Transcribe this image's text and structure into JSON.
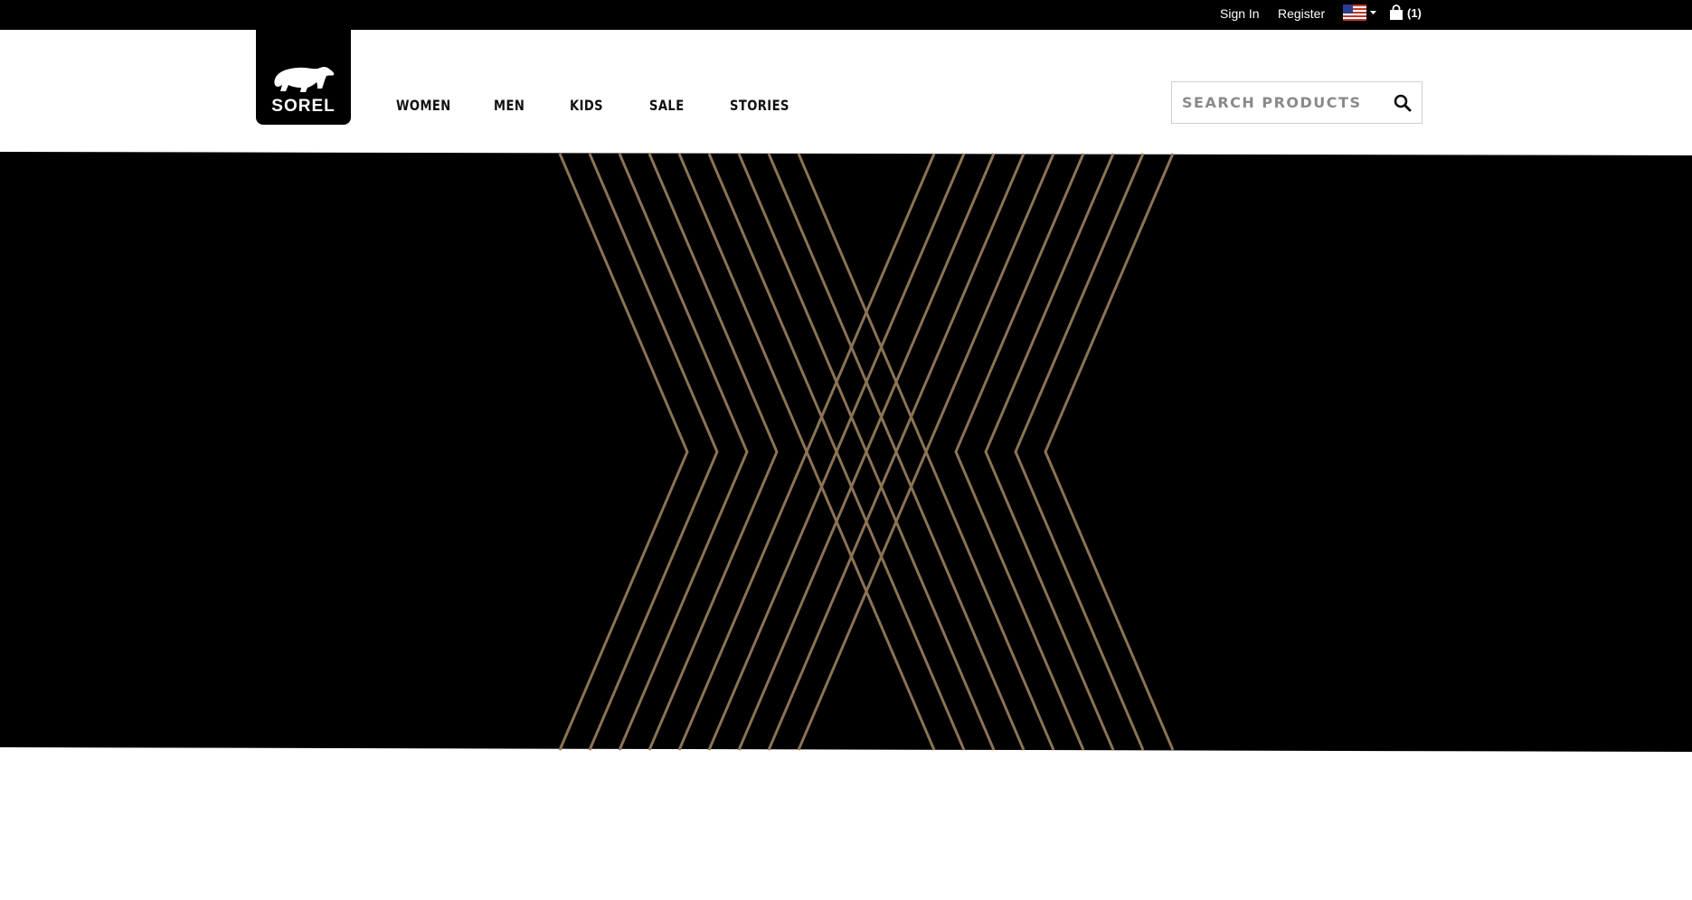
{
  "utility_bar": {
    "sign_in": "Sign In",
    "register": "Register",
    "country_icon": "us-flag-icon",
    "cart_icon": "shopping-bag-icon",
    "cart_count": "(1)"
  },
  "brand": {
    "logo_text": "SOREL",
    "logo_icon": "polar-bear-icon"
  },
  "nav": {
    "items": [
      "WOMEN",
      "MEN",
      "KIDS",
      "SALE",
      "STORIES"
    ]
  },
  "search": {
    "placeholder": "SEARCH PRODUCTS",
    "value": "",
    "icon": "search-icon"
  },
  "hero": {
    "pattern": "gold-diamond-lattice",
    "colors": {
      "background": "#000000",
      "line": "#8b7355"
    }
  },
  "colors": {
    "topbar": "#000000",
    "header": "#ffffff",
    "text_primary": "#111111"
  }
}
